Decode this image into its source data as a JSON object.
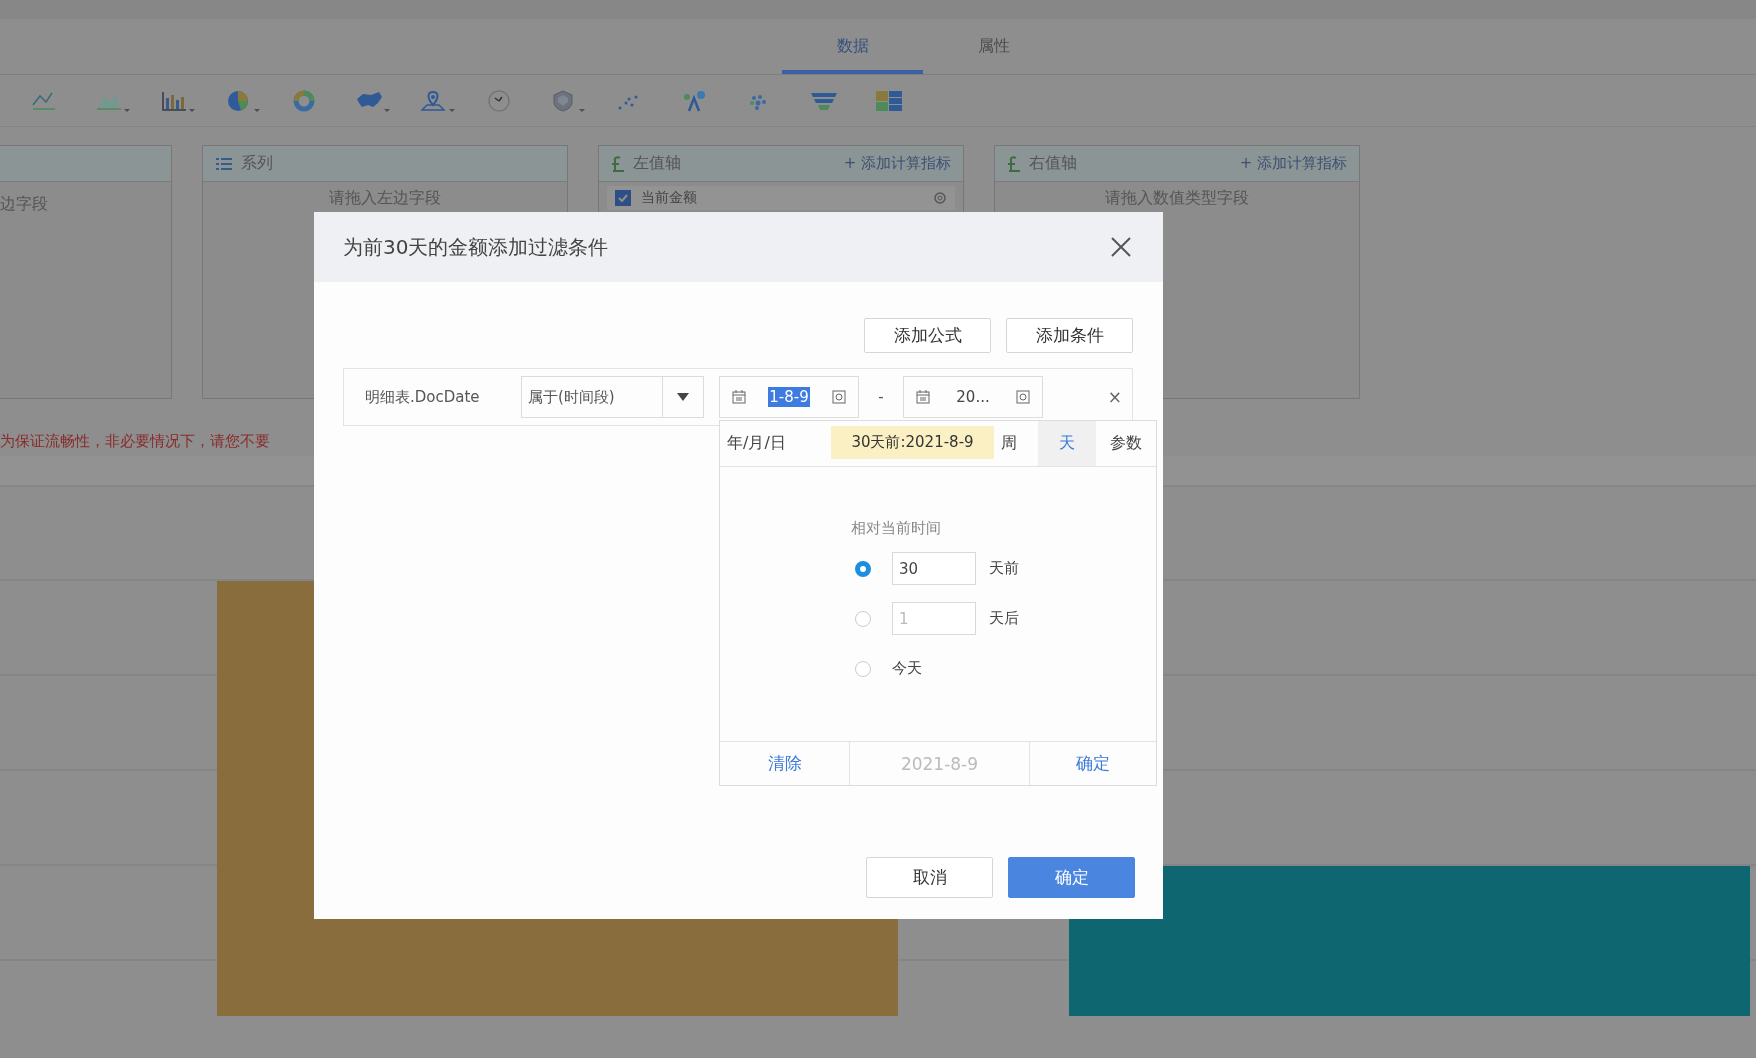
{
  "tabs": [
    {
      "label": "数据",
      "selected": true
    },
    {
      "label": "属性",
      "selected": false
    }
  ],
  "panels": [
    {
      "kind": "plain",
      "placeholder": "边字段"
    },
    {
      "kind": "series",
      "title": "系列",
      "placeholder": "请拖入左边字段"
    },
    {
      "kind": "axis",
      "title": "左值轴",
      "action": "+ 添加计算指标",
      "fields": [
        {
          "label": "当前金额",
          "checked": true
        }
      ]
    },
    {
      "kind": "axis",
      "title": "右值轴",
      "action": "+ 添加计算指标",
      "placeholder": "请拖入数值类型字段"
    }
  ],
  "warning": "为保证流畅性，非必要情况下，请您不要",
  "dialog": {
    "title": "为前30天的金额添加过滤条件",
    "top_buttons": [
      "添加公式",
      "添加条件"
    ],
    "condition": {
      "field": "明细表.DocDate",
      "operator": "属于(时间段)",
      "start": {
        "value": "1-8-9",
        "highlighted": true
      },
      "separator": "-",
      "end": {
        "value": "20...",
        "highlighted": false
      },
      "remove": "×"
    },
    "date_picker": {
      "tabs": [
        {
          "label": "年/月/日",
          "selected": false
        },
        {
          "label": "周",
          "selected": false
        },
        {
          "label": "天",
          "selected": true
        },
        {
          "label": "参数",
          "selected": false
        }
      ],
      "tooltip": "30天前:2021-8-9",
      "section_label": "相对当前时间",
      "options": [
        {
          "selected": true,
          "value": "30",
          "label": "天前"
        },
        {
          "selected": false,
          "value": "1",
          "label": "天后"
        },
        {
          "selected": false,
          "label": "今天"
        }
      ],
      "clear": "清除",
      "preview": "2021-8-9",
      "confirm": "确定"
    },
    "buttons": [
      {
        "label": "取消",
        "kind": "default"
      },
      {
        "label": "确定",
        "kind": "primary"
      }
    ]
  }
}
